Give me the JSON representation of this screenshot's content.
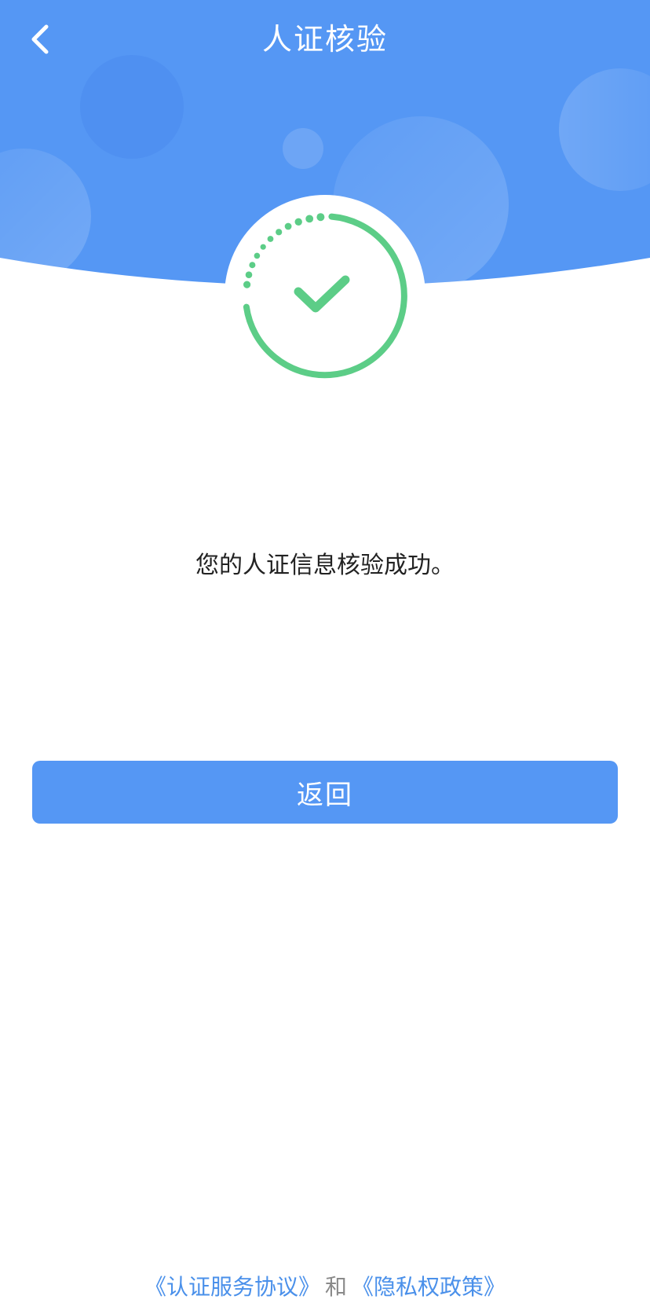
{
  "header": {
    "title": "人证核验",
    "back_icon": "chevron-left-icon"
  },
  "status": {
    "icon": "check-circle-icon",
    "message": "您的人证信息核验成功。"
  },
  "actions": {
    "return_label": "返回"
  },
  "footer": {
    "agreement_link": "《认证服务协议》",
    "connector": "和",
    "privacy_link": "《隐私权政策》"
  },
  "colors": {
    "header_blue": "#5597f4",
    "button_blue": "#5597f4",
    "success_green": "#5ccd87",
    "link_blue": "#4a90ea",
    "text_dark": "#222222",
    "text_gray": "#8a8a8a"
  }
}
